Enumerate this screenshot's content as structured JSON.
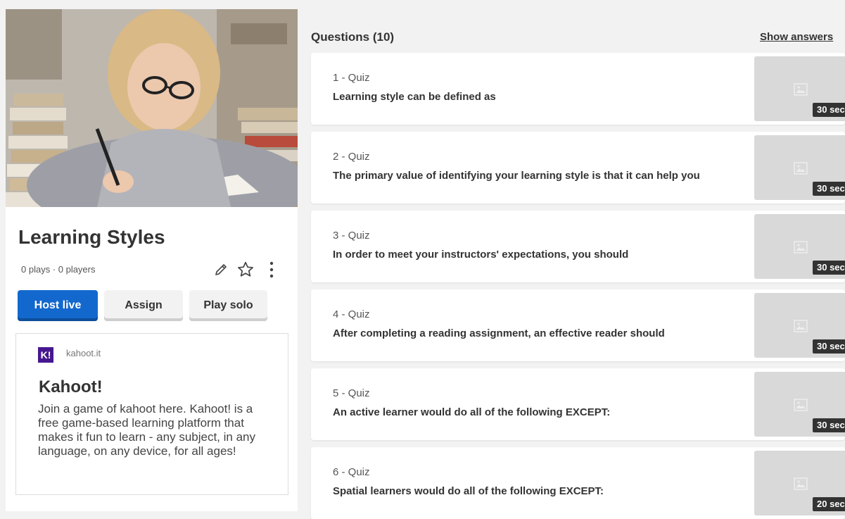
{
  "kahoot": {
    "title": "Learning Styles",
    "stats": "0 plays · 0 players",
    "actions": {
      "host_live": "Host live",
      "assign": "Assign",
      "play_solo": "Play solo"
    }
  },
  "link_card": {
    "logo": "K!",
    "domain": "kahoot.it",
    "title": "Kahoot!",
    "description": "Join a game of kahoot here. Kahoot! is a free game-based learning platform that makes it fun to learn - any subject, in any language, on any device, for all ages!"
  },
  "questions_panel": {
    "heading": "Questions (10)",
    "show_answers": "Show answers",
    "items": [
      {
        "label": "1 - Quiz",
        "text": "Learning style can be defined as",
        "time": "30 sec"
      },
      {
        "label": "2 - Quiz",
        "text": "The primary value of identifying your learning style is that it can help you",
        "time": "30 sec"
      },
      {
        "label": "3 - Quiz",
        "text": "In order to meet your instructors' expectations, you should",
        "time": "30 sec"
      },
      {
        "label": "4 - Quiz",
        "text": "After completing a reading assignment, an effective reader should",
        "time": "30 sec"
      },
      {
        "label": "5 - Quiz",
        "text": "An active learner would do all of the following EXCEPT:",
        "time": "30 sec"
      },
      {
        "label": "6 - Quiz",
        "text": "Spatial learners would do all of the following EXCEPT:",
        "time": "20 sec"
      }
    ]
  },
  "icons": [
    "pencil-icon",
    "star-icon",
    "more-vertical-icon",
    "image-placeholder-icon"
  ],
  "colors": {
    "primary": "#1368ce",
    "kahoot_purple": "#46178f"
  }
}
